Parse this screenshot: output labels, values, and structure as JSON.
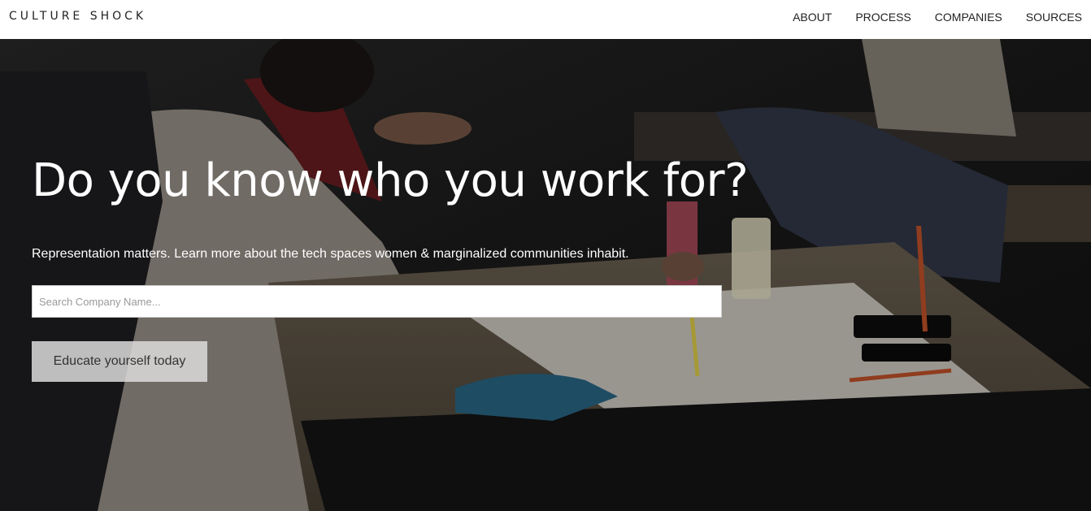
{
  "nav": {
    "brand": "CULTURE SHOCK",
    "links": [
      "ABOUT",
      "PROCESS",
      "COMPANIES",
      "SOURCES"
    ]
  },
  "hero": {
    "title": "Do you know who you work for?",
    "subtitle": "Representation matters. Learn more about the tech spaces women & marginalized communities inhabit.",
    "search_placeholder": "Search Company Name...",
    "cta_label": "Educate yourself today"
  },
  "colors": {
    "nav_background": "#ffffff",
    "nav_text": "#222222",
    "hero_text": "#ffffff",
    "button_background": "#dcdcdc"
  }
}
